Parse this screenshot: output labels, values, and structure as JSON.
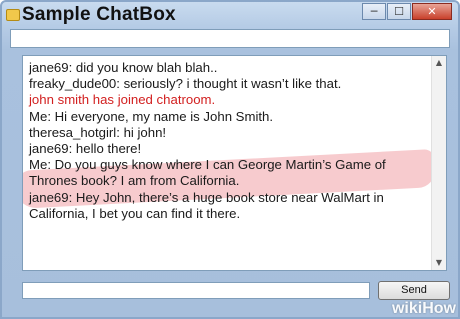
{
  "window": {
    "title": "Sample ChatBox",
    "minimize_glyph": "─",
    "maximize_glyph": "☐",
    "close_glyph": "✕"
  },
  "top_input": {
    "value": ""
  },
  "chat": {
    "messages": [
      {
        "text": "jane69: did you know blah blah..",
        "type": "normal"
      },
      {
        "text": "freaky_dude00: seriously? i thought it wasn’t like that.",
        "type": "normal"
      },
      {
        "text": "john smith has joined chatroom.",
        "type": "system"
      },
      {
        "text": "Me: Hi everyone, my name is John Smith.",
        "type": "normal"
      },
      {
        "text": "theresa_hotgirl: hi john!",
        "type": "normal"
      },
      {
        "text": "jane69: hello there!",
        "type": "normal"
      },
      {
        "text": "Me: Do you guys know where I can George Martin’s Game of Thrones book? I am from California.",
        "type": "highlighted"
      },
      {
        "text": "jane69: Hey John, there’s a huge book store near WalMart in California, I bet you can find it there.",
        "type": "normal"
      }
    ],
    "system_color": "#d21f1f",
    "highlight_color": "#f0a0a5"
  },
  "composer": {
    "input_value": "",
    "send_label": "Send"
  },
  "watermark": "wikiHow"
}
